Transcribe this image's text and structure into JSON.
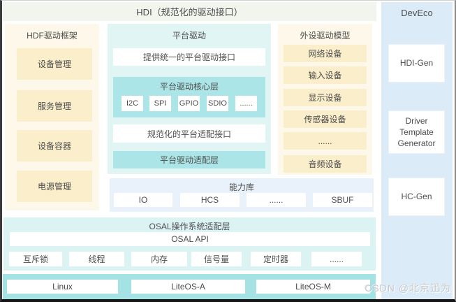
{
  "hdi_bar": {
    "label": "HDI（规范化的驱动接口）"
  },
  "hdf_framework": {
    "title": "HDF驱动框架",
    "items": [
      "设备管理",
      "服务管理",
      "设备容器",
      "电源管理"
    ]
  },
  "platform_driver": {
    "title": "平台驱动",
    "unified_interface": "提供统一的平台驱动接口",
    "core_layer": {
      "title": "平台驱动核心层",
      "items": [
        "I2C",
        "SPI",
        "GPIO",
        "SDIO",
        "......"
      ]
    },
    "adapt_interface": "规范化的平台适配接口",
    "adapt_layer": "平台驱动适配层"
  },
  "peripheral_models": {
    "title": "外设驱动模型",
    "items": [
      "网络设备",
      "输入设备",
      "显示设备",
      "传感器设备",
      "......",
      "音频设备"
    ]
  },
  "capability_lib": {
    "title": "能力库",
    "items": [
      "IO",
      "HCS",
      "......",
      "SBUF"
    ]
  },
  "osal": {
    "title": "OSAL操作系统适配层",
    "api_label": "OSAL API",
    "items": [
      "互斥锁",
      "线程",
      "内存",
      "信号量",
      "定时器",
      "......"
    ]
  },
  "kernels": {
    "items": [
      "Linux",
      "LiteOS-A",
      "LiteOS-M"
    ]
  },
  "deveco": {
    "title": "DevEco",
    "tools": [
      "HDI-Gen",
      "Driver Template Generator",
      "HC-Gen"
    ]
  },
  "watermark": "CSDN @北京迅为",
  "colors": {
    "teal_box": "#abe5e7",
    "yellow_box": "#fbeeca",
    "cream_panel": "#fdf8e9",
    "cyan_panel": "#e1f5f5",
    "blue_panel": "#e9f1fa",
    "deveco_panel": "#dcebf8",
    "kernel_bar": "#a5e2e4",
    "text": "#4d4d4d"
  }
}
